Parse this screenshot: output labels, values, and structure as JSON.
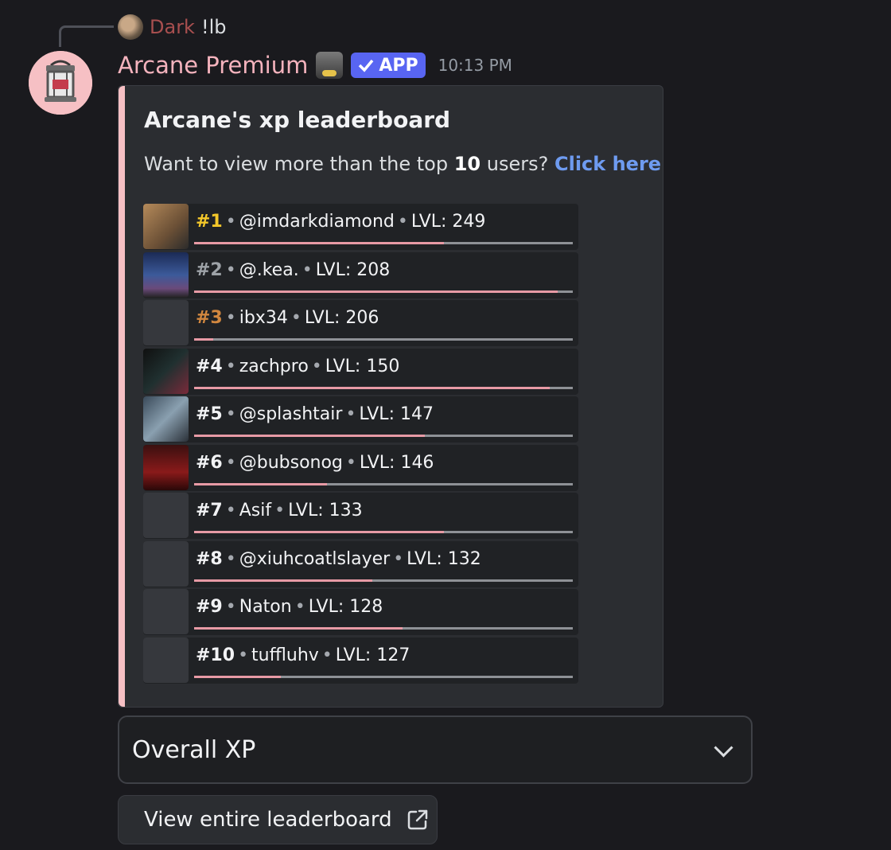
{
  "reply": {
    "author": "Dark",
    "text": "!lb"
  },
  "message": {
    "author": "Arcane Premium",
    "tag": "APP",
    "timestamp": "10:13 PM"
  },
  "embed": {
    "title": "Arcane's xp leaderboard",
    "desc_pre": "Want to view more than the top ",
    "desc_count": "10",
    "desc_post": " users? ",
    "desc_link": "Click here"
  },
  "leaderboard": [
    {
      "rank": "#1",
      "name": "@imdarkdiamond",
      "level": "LVL: 249",
      "progress": 0.66,
      "rank_color": "#f3c72a"
    },
    {
      "rank": "#2",
      "name": "@.kea.",
      "level": "LVL: 208",
      "progress": 0.96,
      "rank_color": "#9ea3a8"
    },
    {
      "rank": "#3",
      "name": "ibx34",
      "level": "LVL: 206",
      "progress": 0.05,
      "rank_color": "#d1873f"
    },
    {
      "rank": "#4",
      "name": "zachpro",
      "level": "LVL: 150",
      "progress": 0.94,
      "rank_color": "#f2f3f5"
    },
    {
      "rank": "#5",
      "name": "@splashtair",
      "level": "LVL: 147",
      "progress": 0.61,
      "rank_color": "#f2f3f5"
    },
    {
      "rank": "#6",
      "name": "@bubsonog",
      "level": "LVL: 146",
      "progress": 0.35,
      "rank_color": "#f2f3f5"
    },
    {
      "rank": "#7",
      "name": "Asif",
      "level": "LVL: 133",
      "progress": 0.66,
      "rank_color": "#f2f3f5"
    },
    {
      "rank": "#8",
      "name": "@xiuhcoatlslayer",
      "level": "LVL: 132",
      "progress": 0.47,
      "rank_color": "#f2f3f5"
    },
    {
      "rank": "#9",
      "name": "Naton",
      "level": "LVL: 128",
      "progress": 0.55,
      "rank_color": "#f2f3f5"
    },
    {
      "rank": "#10",
      "name": "tuffluhv",
      "level": "LVL: 127",
      "progress": 0.23,
      "rank_color": "#f2f3f5"
    }
  ],
  "select": {
    "value": "Overall XP"
  },
  "button": {
    "label": "View entire leaderboard"
  }
}
